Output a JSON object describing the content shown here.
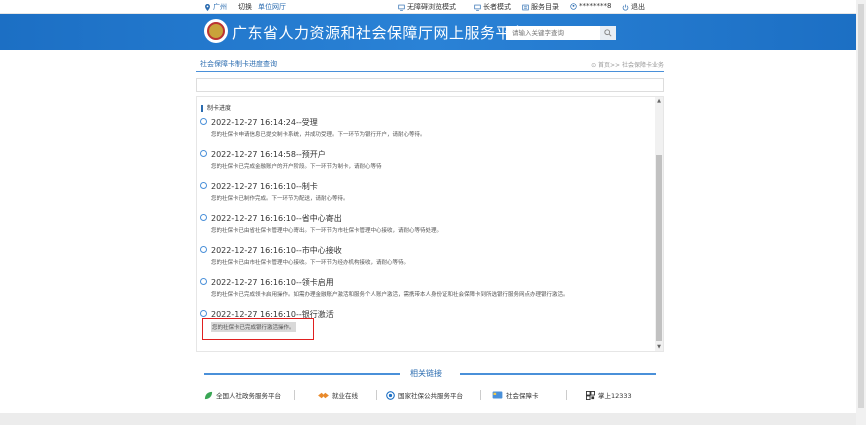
{
  "topbar": {
    "location": "广州",
    "switch": "切换",
    "unit_hall": "单位网厅",
    "accessible_mode": "无障碍浏览模式",
    "elder_mode": "长者模式",
    "service_catalog": "服务目录",
    "user": "********8",
    "logout": "退出"
  },
  "header": {
    "title": "广东省人力资源和社会保障厅网上服务平台",
    "search_placeholder": "请输入关键字查询"
  },
  "page": {
    "title": "社会保障卡制卡进度查询",
    "breadcrumb": "首页>> 社会保障卡业务"
  },
  "progress": {
    "section_label": "制卡进度",
    "entries": [
      {
        "head": "2022-12-27 16:14:24--受理",
        "desc": "您的社保卡申请信息已提交制卡系统，并成功受理。下一环节为银行开户，请耐心等待。"
      },
      {
        "head": "2022-12-27 16:14:58--预开户",
        "desc": "您的社保卡已完成金融账户的开户阶段。下一环节为制卡，请耐心等待"
      },
      {
        "head": "2022-12-27 16:16:10--制卡",
        "desc": "您的社保卡已制作完成。下一环节为配送，请耐心等待。"
      },
      {
        "head": "2022-12-27 16:16:10--省中心寄出",
        "desc": "您的社保卡已由省社保卡管理中心寄出。下一环节为市社保卡管理中心接收，请耐心等待处理。"
      },
      {
        "head": "2022-12-27 16:16:10--市中心接收",
        "desc": "您的社保卡已由市社保卡管理中心接收。下一环节为经办机构接收，请耐心等待。"
      },
      {
        "head": "2022-12-27 16:16:10--领卡启用",
        "desc": "您的社保卡已完成领卡启用操作。如需办理金融账户激活和服务个人账户激活，需携带本人身份证和社会保障卡到所选银行服务网点办理银行激活。"
      },
      {
        "head": "2022-12-27 16:16:10--银行激活",
        "desc": "您的社保卡已完成银行激活操作。"
      }
    ]
  },
  "related": {
    "label": "相关链接",
    "links": [
      {
        "label": "全国人社政务服务平台",
        "icon": "leaf-icon"
      },
      {
        "label": "就业在线",
        "icon": "handshake-icon"
      },
      {
        "label": "国家社保公共服务平台",
        "icon": "emblem-icon"
      },
      {
        "label": "社会保障卡",
        "icon": "card-icon"
      },
      {
        "label": "掌上12333",
        "icon": "qrcode-icon"
      }
    ]
  },
  "colors": {
    "brand_blue": "#1c6fc4",
    "link_blue": "#2b6cb0",
    "highlight_red": "#e02020"
  }
}
